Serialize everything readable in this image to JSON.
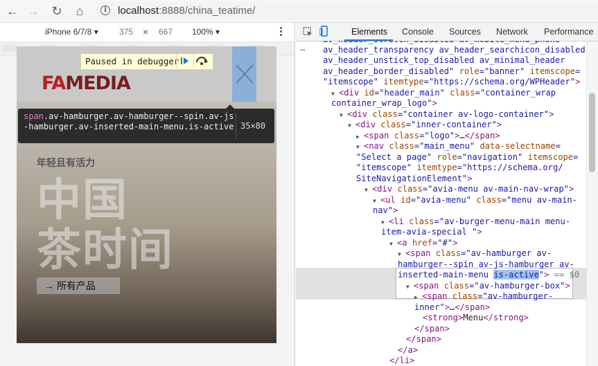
{
  "browser": {
    "url_host": "localhost",
    "url_rest": ":8888/china_teatime/"
  },
  "device_toolbar": {
    "device": "iPhone 6/7/8 ▾",
    "width": "375",
    "times": "×",
    "height": "667",
    "zoom": "100% ▾"
  },
  "site": {
    "logo_fa": "FA",
    "logo_rest": "MEDIA",
    "tagline": "年轻且有活力",
    "title_line1": "中国",
    "title_line2": "茶时间",
    "cta": "→ 所有产品"
  },
  "debugger": {
    "paused_label": "Paused in debugger"
  },
  "tooltip": {
    "tag": "span",
    "classes": ".av-hamburger.av-hamburger--spin.av-js-hamburger.av-inserted-main-menu.is-active",
    "dims": "35×80"
  },
  "devtools": {
    "tabs": [
      "Elements",
      "Console",
      "Sources",
      "Network",
      "Performance"
    ],
    "ellipsis": "…",
    "selected_suffix": " == $0",
    "lines": [
      {
        "indent": 0,
        "html": "<span class='av'>av_header_stretch_disabled av_mobile_menu_phone</span>"
      },
      {
        "indent": 0,
        "html": "<span class='av'>av_header_transparency av_header_searchicon_disabled</span>"
      },
      {
        "indent": 0,
        "html": "<span class='av'>av_header_unstick_top_disabled av_minimal_header</span>"
      },
      {
        "indent": 0,
        "html": "<span class='av'>av_header_border_disabled\"</span> <span class='an'>role</span>=<span class='av'>\"banner\"</span> <span class='an'>itemscope</span>="
      },
      {
        "indent": 0,
        "html": "<span class='av'>\"itemscope\"</span> <span class='an'>itemtype</span>=<span class='av'>\"https://schema.org/WPHeader\"</span>&gt;"
      }
    ]
  }
}
